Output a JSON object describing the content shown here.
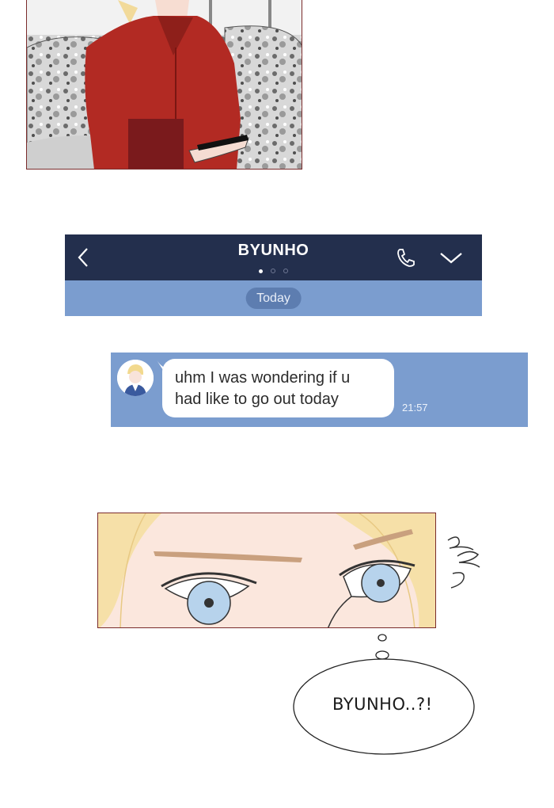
{
  "chat": {
    "contact_name": "BYUNHO",
    "date_label": "Today",
    "message": {
      "line1": "uhm I was wondering if u",
      "line2": "had like to go out today",
      "time": "21:57"
    }
  },
  "thought": {
    "text": "BYUNHO..?!"
  },
  "icons": {
    "back": "chevron-left-icon",
    "call": "phone-icon",
    "menu": "chevron-down-icon"
  },
  "colors": {
    "navbar": "#232f4d",
    "chat_background": "#7b9dcf",
    "date_pill": "#5d7db0",
    "panel_border": "#7a2b2b",
    "shirt": "#b22a23"
  }
}
